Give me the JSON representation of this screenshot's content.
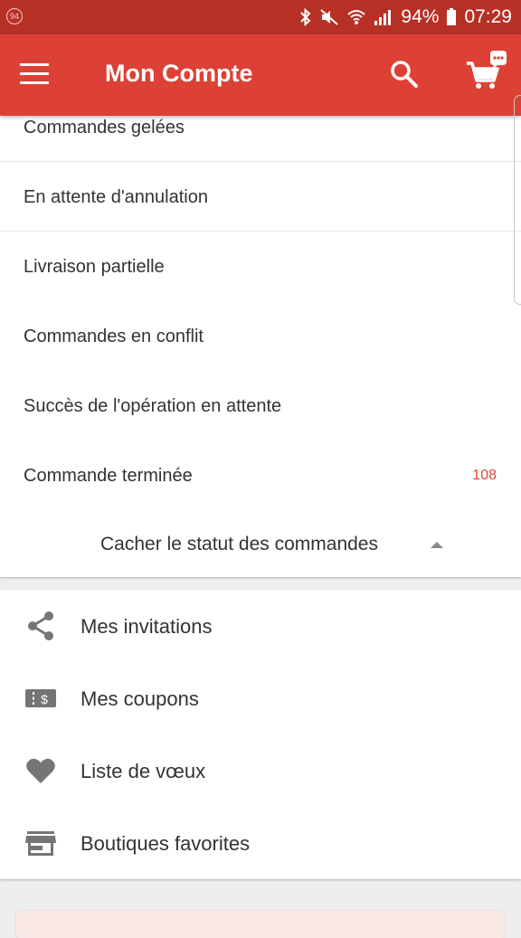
{
  "statusbar": {
    "notification_badge": "94",
    "battery": "94%",
    "time": "07:29"
  },
  "appbar": {
    "title": "Mon Compte",
    "menu_icon": "hamburger-menu-icon",
    "search_icon": "search-icon",
    "cart_icon": "shopping-cart-icon"
  },
  "order_status": {
    "items": [
      {
        "label": "Commandes gelées",
        "count": ""
      },
      {
        "label": "En attente d'annulation",
        "count": ""
      },
      {
        "label": "Livraison partielle",
        "count": ""
      },
      {
        "label": "Commandes en conflit",
        "count": ""
      },
      {
        "label": "Succès de l'opération en attente",
        "count": ""
      },
      {
        "label": "Commande terminée",
        "count": "108"
      }
    ],
    "toggle_label": "Cacher le statut des commandes"
  },
  "menu": {
    "items": [
      {
        "label": "Mes invitations",
        "icon": "share-icon"
      },
      {
        "label": "Mes coupons",
        "icon": "coupon-icon"
      },
      {
        "label": "Liste de vœux",
        "icon": "heart-icon"
      },
      {
        "label": "Boutiques favorites",
        "icon": "store-icon"
      }
    ]
  },
  "colors": {
    "statusbar": "#b73025",
    "appbar": "#dd4035",
    "accent_count": "#e04437",
    "icon": "#757575"
  }
}
